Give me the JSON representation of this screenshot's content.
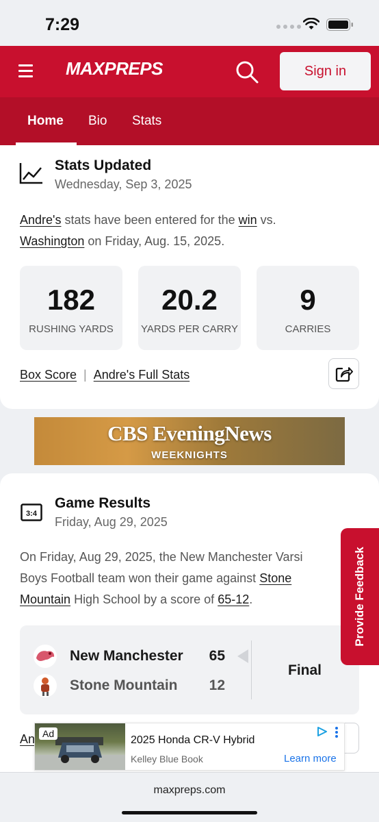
{
  "status_bar": {
    "time": "7:29"
  },
  "header": {
    "logo": "MAXPREPS",
    "signin_label": "Sign in"
  },
  "tabs": [
    {
      "label": "Home"
    },
    {
      "label": "Bio"
    },
    {
      "label": "Stats"
    }
  ],
  "stats_card": {
    "title": "Stats Updated",
    "date": "Wednesday, Sep 3, 2025",
    "body_player": "Andre's",
    "body_text1": " stats have been entered for the ",
    "body_result": "win",
    "body_text2": " vs.",
    "body_opponent": "Washington",
    "body_text3": " on Friday, Aug. 15, 2025.",
    "stats": [
      {
        "value": "182",
        "label": "RUSHING YARDS"
      },
      {
        "value": "20.2",
        "label": "YARDS PER CARRY"
      },
      {
        "value": "9",
        "label": "CARRIES"
      }
    ],
    "box_score_link": "Box Score",
    "full_stats_link": "Andre's Full Stats",
    "separator": "|"
  },
  "banner_ad": {
    "line1": "CBS EveningNews",
    "line2": "WEEKNIGHTS"
  },
  "game_card": {
    "title": "Game Results",
    "date": "Friday, Aug 29, 2025",
    "body_text1": "On Friday, Aug 29, 2025, the New Manchester Varsi",
    "body_text2": "Boys Football team won their game against ",
    "body_opponent_a": "Stone",
    "body_opponent_b": "Mountain",
    "body_text3": " High School by a score of ",
    "body_score": "65-12",
    "body_text4": ".",
    "teams": [
      {
        "name": "New Manchester",
        "score": "65"
      },
      {
        "name": "Stone Mountain",
        "score": "12"
      }
    ],
    "status": "Final",
    "partial_link": "An"
  },
  "feedback_tab": {
    "label": "Provide Feedback"
  },
  "bottom_ad": {
    "badge": "Ad",
    "title": "2025 Honda CR-V Hybrid",
    "source": "Kelley Blue Book",
    "cta": "Learn more"
  },
  "browser": {
    "url": "maxpreps.com"
  },
  "colors": {
    "brand_red": "#c8102e",
    "tab_red": "#b30f28",
    "link_blue": "#1a73e8"
  }
}
